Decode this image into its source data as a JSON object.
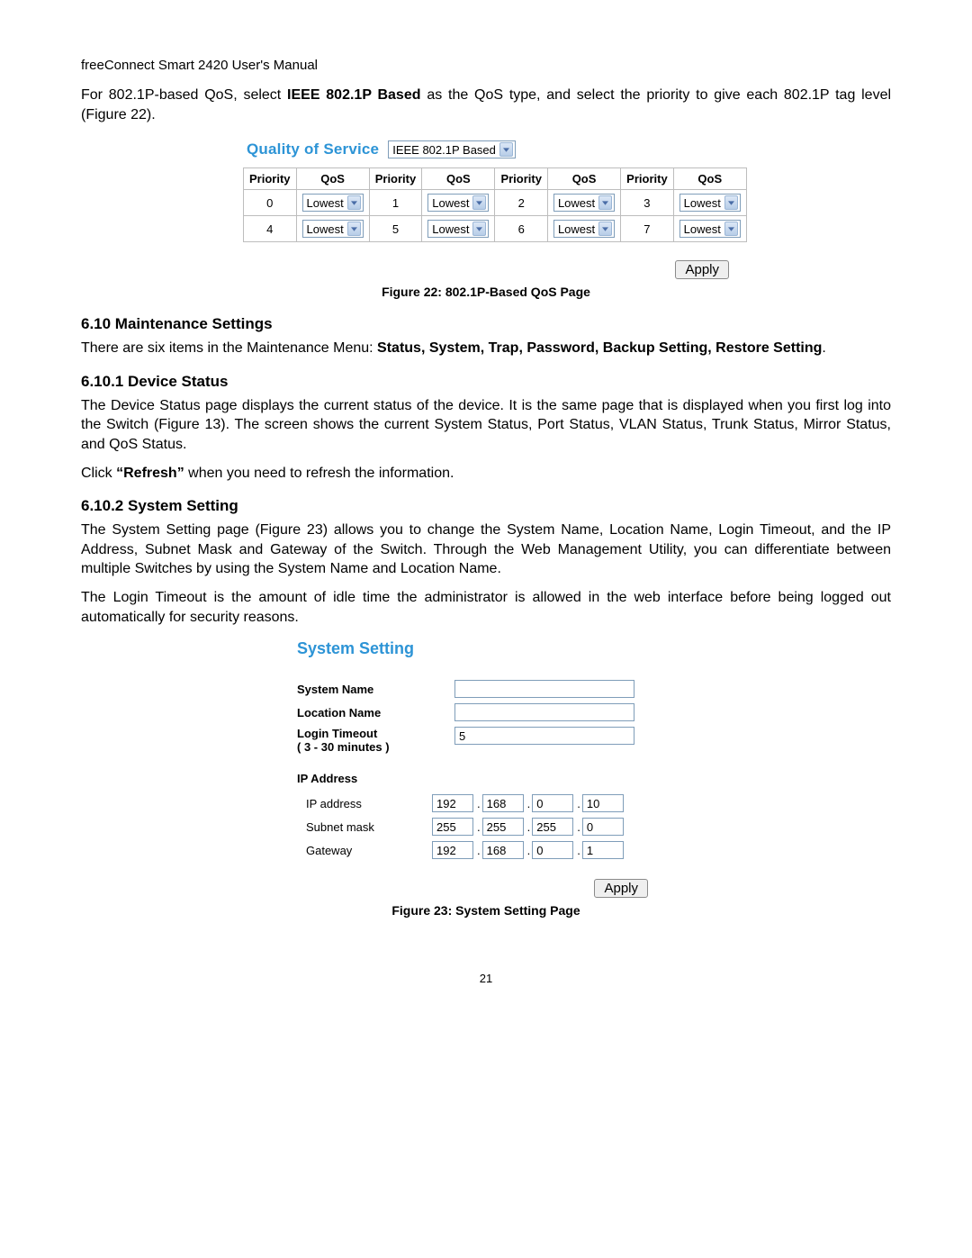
{
  "header": "freeConnect Smart 2420 User's Manual",
  "intro": {
    "pre": "For 802.1P-based QoS, select ",
    "bold": "IEEE 802.1P Based",
    "post": " as the QoS type, and select the priority to give each 802.1P tag level (Figure 22)."
  },
  "qos": {
    "title": "Quality of Service",
    "type_selected": "IEEE 802.1P Based",
    "headers": {
      "priority": "Priority",
      "qos": "QoS"
    },
    "rows": [
      [
        {
          "priority": "0",
          "qos": "Lowest"
        },
        {
          "priority": "1",
          "qos": "Lowest"
        },
        {
          "priority": "2",
          "qos": "Lowest"
        },
        {
          "priority": "3",
          "qos": "Lowest"
        }
      ],
      [
        {
          "priority": "4",
          "qos": "Lowest"
        },
        {
          "priority": "5",
          "qos": "Lowest"
        },
        {
          "priority": "6",
          "qos": "Lowest"
        },
        {
          "priority": "7",
          "qos": "Lowest"
        }
      ]
    ],
    "apply": "Apply",
    "caption": "Figure 22: 802.1P-Based QoS Page"
  },
  "s610": {
    "heading": "6.10  Maintenance Settings",
    "text_pre": "There are six items in the Maintenance Menu: ",
    "text_bold": "Status, System, Trap, Password, Backup Setting, Restore Setting",
    "text_post": "."
  },
  "s6101": {
    "heading": "6.10.1 Device Status",
    "p1": "The Device Status page displays the current status of the device.  It is the same page that is displayed when you first log into the Switch (Figure 13).  The screen shows the current System Status, Port Status, VLAN Status, Trunk Status, Mirror Status, and QoS Status.",
    "p2_pre": "Click ",
    "p2_bold": "“Refresh”",
    "p2_post": " when you need to refresh the information."
  },
  "s6102": {
    "heading": "6.10.2 System Setting",
    "p1": "The System Setting page (Figure 23) allows you to change the System Name, Location Name, Login Timeout, and the IP Address, Subnet Mask and Gateway of the Switch. Through the Web Management Utility, you can differentiate between multiple Switches by using the System Name and Location Name.",
    "p2": "The Login Timeout is the amount of idle time the administrator is allowed in the web interface before being logged out automatically for security reasons."
  },
  "sys": {
    "title": "System Setting",
    "labels": {
      "system_name": "System Name",
      "location_name": "Location Name",
      "login_timeout_l1": "Login Timeout",
      "login_timeout_l2": "( 3 - 30 minutes )",
      "ip_heading": "IP Address",
      "ip_address": "IP address",
      "subnet_mask": "Subnet mask",
      "gateway": "Gateway"
    },
    "values": {
      "system_name": "",
      "location_name": "",
      "login_timeout": "5",
      "ip": [
        "192",
        "168",
        "0",
        "10"
      ],
      "mask": [
        "255",
        "255",
        "255",
        "0"
      ],
      "gw": [
        "192",
        "168",
        "0",
        "1"
      ]
    },
    "apply": "Apply",
    "caption": "Figure 23: System Setting Page"
  },
  "page_number": "21"
}
